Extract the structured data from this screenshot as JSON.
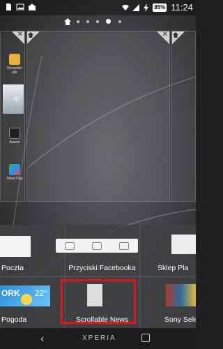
{
  "status_bar": {
    "battery": "85%",
    "time": "11:24",
    "icons": [
      "sd-card-icon",
      "gallery-icon",
      "upload-icon",
      "wifi-icon",
      "signal-icon",
      "charging-icon",
      "battery-icon"
    ]
  },
  "left_pane": {
    "apps": [
      {
        "label": "Menedżer plik",
        "icon": "file-manager-icon"
      },
      {
        "label": "Aparat",
        "icon": "camera-icon"
      },
      {
        "label": "Sklep Play",
        "icon": "play-store-icon"
      }
    ],
    "weather_temp": "-5°"
  },
  "widgets": [
    {
      "label": "Poczta",
      "icon": "email-preview"
    },
    {
      "label": "Przyciski Facebooka",
      "icon": "facebook-buttons-preview"
    },
    {
      "label": "Sklep Pla",
      "icon": "play-store-preview"
    },
    {
      "label": "Pogoda",
      "icon": "weather-preview",
      "city": "ORK",
      "temp": "22°"
    },
    {
      "label": "Scrollable News",
      "icon": "news-preview"
    },
    {
      "label": "Sony Sele",
      "icon": "sony-select-preview"
    }
  ],
  "nav_bar": {
    "brand": "XPERIA"
  },
  "colors": {
    "highlight": "#e0141b"
  }
}
